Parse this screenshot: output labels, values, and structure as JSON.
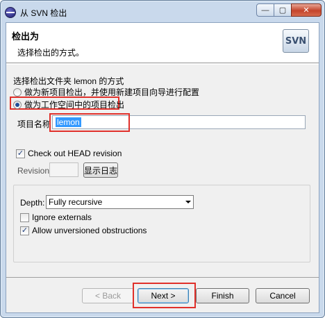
{
  "window": {
    "title": "从 SVN 检出",
    "icon": "eclipse-icon",
    "controls": {
      "minimize": "—",
      "maximize": "▢",
      "close": "✕"
    }
  },
  "banner": {
    "title": "检出为",
    "description": "选择检出的方式。",
    "logo_text": "SVN"
  },
  "checkout_mode": {
    "heading": "选择检出文件夹 lemon 的方式",
    "options": [
      {
        "label": "做为新项目检出，并使用新建项目向导进行配置",
        "selected": false
      },
      {
        "label": "做为工作空间中的项目检出",
        "selected": true
      }
    ]
  },
  "project_name": {
    "label": "项目名称",
    "value": "lemon"
  },
  "head_revision": {
    "label": "Check out HEAD revision",
    "checked": true
  },
  "revision": {
    "label": "Revision:",
    "value": "",
    "show_log_button": "显示日志"
  },
  "depth": {
    "label": "Depth:",
    "selected": "Fully recursive"
  },
  "ignore_externals": {
    "label": "Ignore externals",
    "checked": false
  },
  "allow_unversioned": {
    "label": "Allow unversioned obstructions",
    "checked": true
  },
  "footer": {
    "back": "< Back",
    "next": "Next >",
    "finish": "Finish",
    "cancel": "Cancel"
  },
  "colors": {
    "highlight": "#e0302a",
    "selection": "#3399ff"
  }
}
